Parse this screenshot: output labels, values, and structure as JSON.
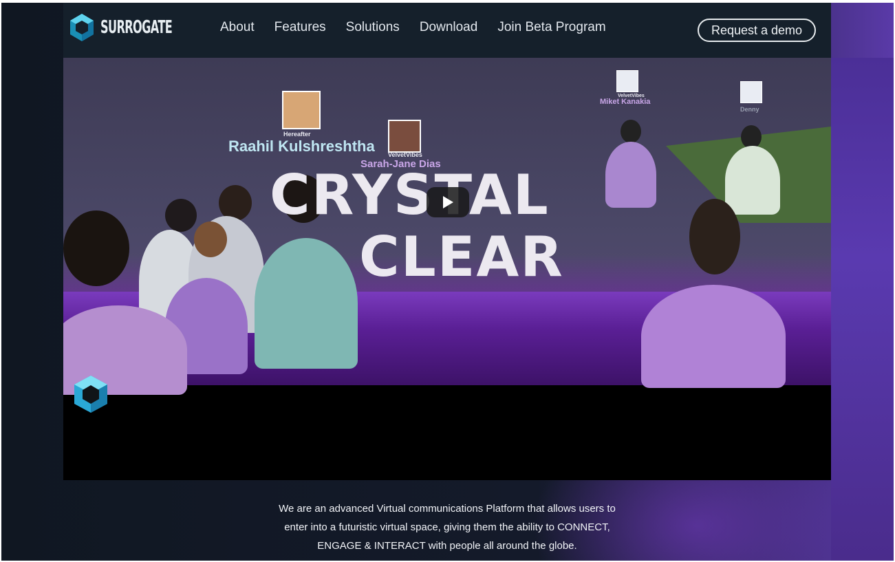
{
  "brand": {
    "name": "SURROGATE"
  },
  "nav": {
    "items": [
      "About",
      "Features",
      "Solutions",
      "Download",
      "Join Beta Program"
    ],
    "cta": "Request a demo"
  },
  "video": {
    "title_line1": "CRYSTAL",
    "title_line2": "CLEAR",
    "participants": [
      {
        "name": "Raahil Kulshreshtha",
        "handle": "Hereafter"
      },
      {
        "name": "Sarah-Jane Dias",
        "handle": "VelvetVibes"
      },
      {
        "name": "Miket Kanakia",
        "handle": "VelvetVibes"
      },
      {
        "name": "Denny",
        "handle": ""
      }
    ]
  },
  "tagline": [
    "We are an advanced Virtual communications Platform that allows users to",
    "enter into a futuristic virtual space, giving them the ability to CONNECT,",
    "ENGAGE & INTERACT with people all around the globe."
  ],
  "colors": {
    "header_bg": "#15202b",
    "accent_purple": "#5a3ab0",
    "logo_cyan": "#2fb8dc"
  }
}
